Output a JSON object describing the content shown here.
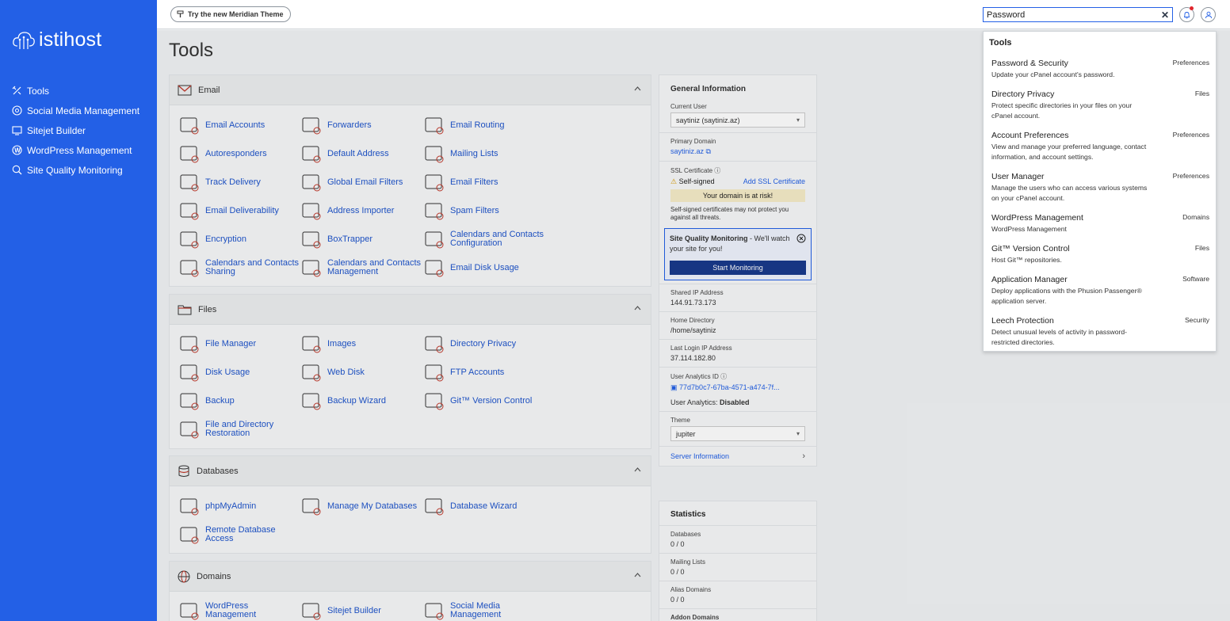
{
  "sidebar": {
    "logo_text": "istihost",
    "items": [
      {
        "label": "Tools",
        "icon": "tools-icon"
      },
      {
        "label": "Social Media Management",
        "icon": "social-icon"
      },
      {
        "label": "Sitejet Builder",
        "icon": "sitejet-icon"
      },
      {
        "label": "WordPress Management",
        "icon": "wordpress-icon"
      },
      {
        "label": "Site Quality Monitoring",
        "icon": "quality-search-icon"
      }
    ]
  },
  "topbar": {
    "theme_button": "Try the new Meridian Theme",
    "search_value": "Password",
    "clear_symbol": "✕"
  },
  "page": {
    "title": "Tools"
  },
  "panels": {
    "email": {
      "title": "Email",
      "tools": [
        "Email Accounts",
        "Forwarders",
        "Email Routing",
        "Autoresponders",
        "Default Address",
        "Mailing Lists",
        "Track Delivery",
        "Global Email Filters",
        "Email Filters",
        "Email Deliverability",
        "Address Importer",
        "Spam Filters",
        "Encryption",
        "BoxTrapper",
        "Calendars and Contacts Configuration",
        "Calendars and Contacts Sharing",
        "Calendars and Contacts Management",
        "Email Disk Usage"
      ]
    },
    "files": {
      "title": "Files",
      "tools": [
        "File Manager",
        "Images",
        "Directory Privacy",
        "Disk Usage",
        "Web Disk",
        "FTP Accounts",
        "Backup",
        "Backup Wizard",
        "Git™ Version Control",
        "File and Directory Restoration"
      ]
    },
    "databases": {
      "title": "Databases",
      "tools": [
        "phpMyAdmin",
        "Manage My Databases",
        "Database Wizard",
        "Remote Database Access"
      ]
    },
    "domains": {
      "title": "Domains",
      "tools": [
        "WordPress Management",
        "Sitejet Builder",
        "Social Media Management"
      ]
    }
  },
  "info": {
    "title": "General Information",
    "current_user_label": "Current User",
    "current_user_value": "saytiniz (saytiniz.az)",
    "primary_domain_label": "Primary Domain",
    "primary_domain_value": "saytiniz.az",
    "ssl_label": "SSL Certificate",
    "ssl_status": "Self-signed",
    "ssl_add": "Add SSL Certificate",
    "ssl_risk": "Your domain is at risk!",
    "ssl_note": "Self-signed certificates may not protect you against all threats.",
    "sqm_title": "Site Quality Monitoring",
    "sqm_text": " - We'll watch your site for you!",
    "sqm_button": "Start Monitoring",
    "shared_ip_label": "Shared IP Address",
    "shared_ip_value": "144.91.73.173",
    "home_dir_label": "Home Directory",
    "home_dir_value": "/home/saytiniz",
    "last_login_label": "Last Login IP Address",
    "last_login_value": "37.114.182.80",
    "analytics_id_label": "User Analytics ID",
    "analytics_id_value": "77d7b0c7-67ba-4571-a474-7f...",
    "analytics_status_label": "User Analytics:",
    "analytics_status_value": "Disabled",
    "theme_label": "Theme",
    "theme_value": "jupiter",
    "server_info": "Server Information"
  },
  "stats": {
    "title": "Statistics",
    "items": [
      {
        "label": "Databases",
        "value": "0 / 0"
      },
      {
        "label": "Mailing Lists",
        "value": "0 / 0"
      },
      {
        "label": "Alias Domains",
        "value": "0 / 0"
      },
      {
        "label": "Addon Domains",
        "value": ""
      }
    ]
  },
  "dropdown": {
    "heading": "Tools",
    "items": [
      {
        "title": "Password & Security",
        "desc": "Update your cPanel account's password.",
        "cat": "Preferences"
      },
      {
        "title": "Directory Privacy",
        "desc": "Protect specific directories in your files on your cPanel account.",
        "cat": "Files"
      },
      {
        "title": "Account Preferences",
        "desc": "View and manage your preferred language, contact information, and account settings.",
        "cat": "Preferences"
      },
      {
        "title": "User Manager",
        "desc": "Manage the users who can access various systems on your cPanel account.",
        "cat": "Preferences"
      },
      {
        "title": "WordPress Management",
        "desc": "WordPress Management",
        "cat": "Domains"
      },
      {
        "title": "Git™ Version Control",
        "desc": "Host Git™ repositories.",
        "cat": "Files"
      },
      {
        "title": "Application Manager",
        "desc": "Deploy applications with the Phusion Passenger® application server.",
        "cat": "Software"
      },
      {
        "title": "Leech Protection",
        "desc": "Detect unusual levels of activity in password-restricted directories.",
        "cat": "Security"
      }
    ]
  },
  "colors": {
    "brand": "#2360e6",
    "button_dark": "#193a8c",
    "risk_bg": "#f6ecc8"
  }
}
